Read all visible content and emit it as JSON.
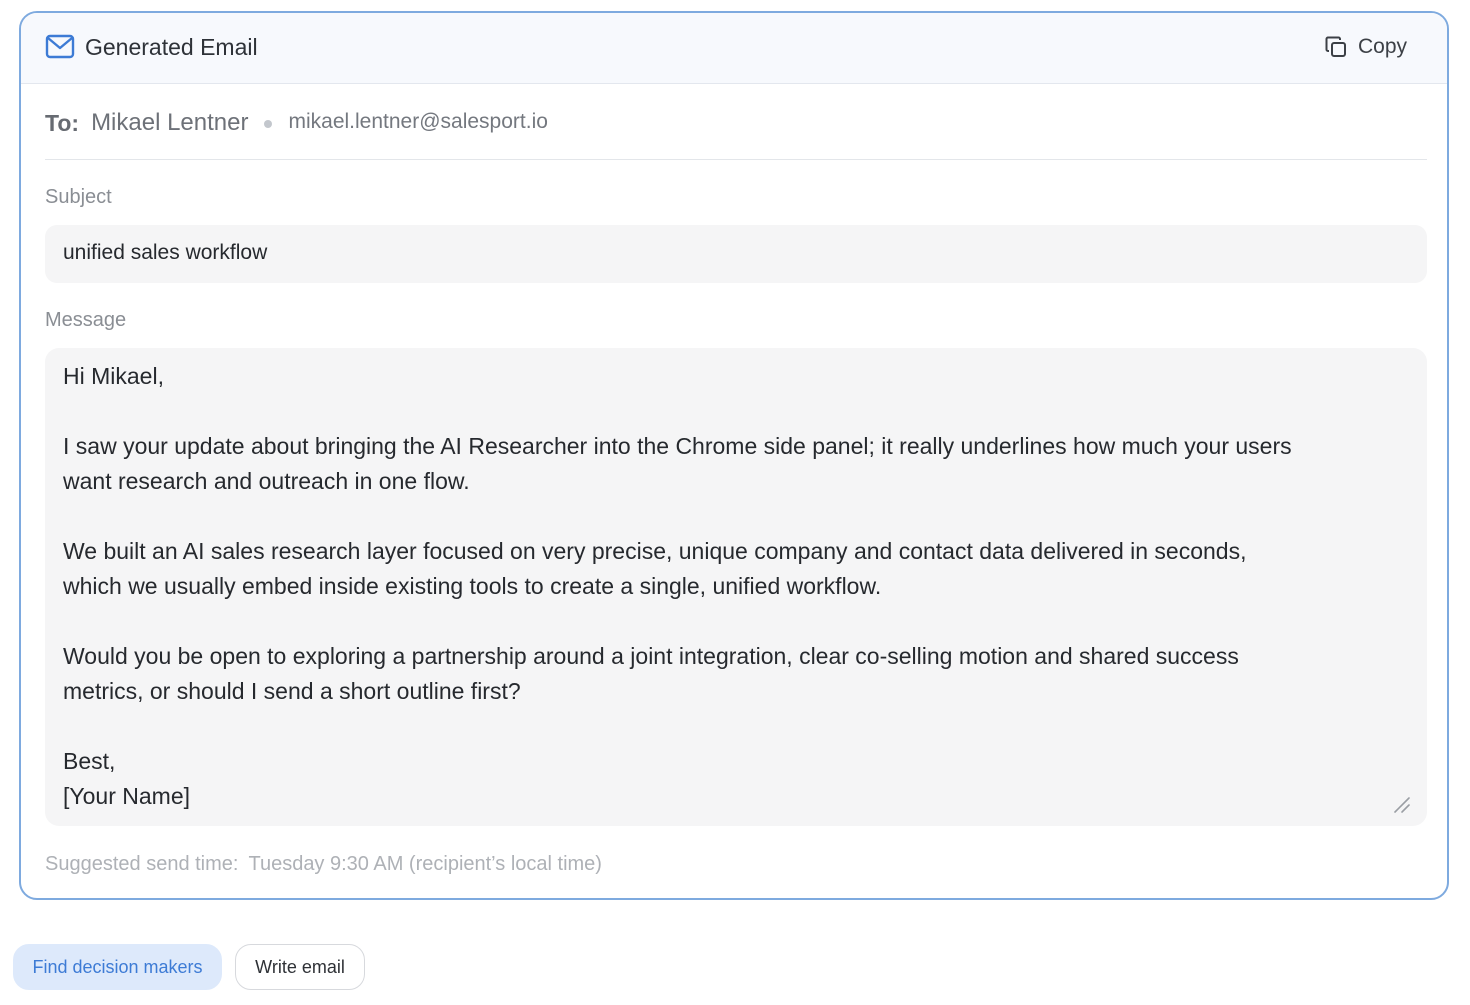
{
  "header": {
    "icon": "mail-icon",
    "title": "Generated Email",
    "copy_icon": "copy-icon",
    "copy_label": "Copy"
  },
  "recipient": {
    "to_label": "To:",
    "name": "Mikael Lentner",
    "email": "mikael.lentner@salesport.io"
  },
  "subject": {
    "label": "Subject",
    "value": "unified sales workflow"
  },
  "message": {
    "label": "Message",
    "lines": [
      "Hi Mikael,",
      "",
      "I saw your update about bringing the AI Researcher into the Chrome side panel; it really underlines how much your users",
      "want research and outreach in one flow.",
      "",
      "We built an AI sales research layer focused on very precise, unique company and contact data delivered in seconds,",
      "which we usually embed inside existing tools to create a single, unified workflow.",
      "",
      "Would you be open to exploring a partnership around a joint integration, clear co-selling motion and shared success",
      "metrics, or should I send a short outline first?",
      "",
      "Best,",
      "[Your Name]"
    ]
  },
  "send_time": {
    "label": "Suggested send time:",
    "value": "Tuesday 9:30 AM (recipient’s local time)"
  },
  "actions": {
    "find_decision_makers": "Find decision makers",
    "write_email": "Write email"
  },
  "colors": {
    "card_border": "#7eaadf",
    "accent": "#3d7bd5",
    "accent_bg": "#dde9fb",
    "field_bg": "#f5f5f6"
  }
}
